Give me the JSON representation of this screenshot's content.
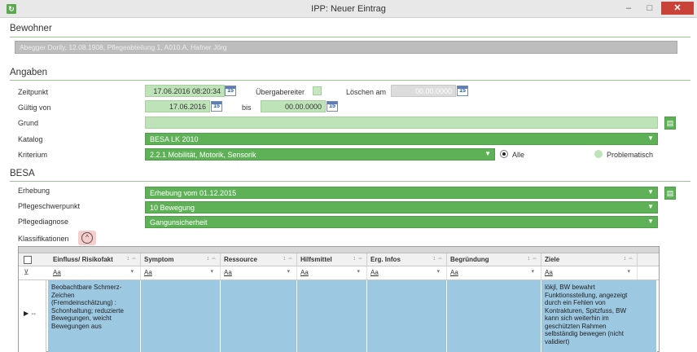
{
  "window": {
    "title": "IPP: Neuer Eintrag",
    "min_glyph": "–",
    "max_glyph": "□",
    "close_glyph": "✕"
  },
  "bewohner": {
    "heading": "Bewohner",
    "value": "Abegger Dorily, 12.08.1908, Pflegeabteilung 1, A010.A, Hafner Jörg"
  },
  "angaben": {
    "heading": "Angaben",
    "zeitpunkt_label": "Zeitpunkt",
    "zeitpunkt_value": "17.06.2016 08:20:34",
    "uebergabe_label": "Übergabereiter",
    "loeschen_label": "Löschen am",
    "loeschen_value": "00.00.0000",
    "gueltig_label": "Gültig von",
    "gueltig_value": "17.06.2016",
    "bis_label": "bis",
    "bis_value": "00.00.0000",
    "grund_label": "Grund",
    "grund_value": "",
    "katalog_label": "Katalog",
    "katalog_value": "BESA LK 2010",
    "kriterium_label": "Kriterium",
    "kriterium_value": "2.2.1   Mobilität, Motorik, Sensorik",
    "filter_alle": "Alle",
    "filter_problematisch": "Problematisch",
    "calendar_glyph": "15"
  },
  "besa": {
    "heading": "BESA",
    "erhebung_label": "Erhebung",
    "erhebung_value": "Erhebung vom   01.12.2015",
    "schwerpunkt_label": "Pflegeschwerpunkt",
    "schwerpunkt_value": "10   Bewegung",
    "diagnose_label": "Pflegediagnose",
    "diagnose_value": "Gangunsicherheit",
    "klassifikationen_label": "Klassifikationen",
    "collapse_glyph": "^"
  },
  "grid": {
    "filter_placeholder": "Aa",
    "sort_glyph": "↕ ⇔",
    "columns": [
      "Einfluss/ Risikofakt",
      "Symptom",
      "Ressource",
      "Hilfsmittel",
      "Erg. Infos",
      "Begründung",
      "Ziele"
    ],
    "row": {
      "marker": "▶ ⇔",
      "cells": [
        "Beobachtbare Schmerz-\nZeichen\n(Fremdeinschätzung) :\nSchonhaltung; reduzierte\nBewegungen, weicht\nBewegungen aus",
        "",
        "",
        "",
        "",
        "",
        "lökjl, BW bewahrt\nFunktionsstellung, angezeigt\ndurch ein Fehlen von\nKontrakturen, Spitzfuss, BW\nkann sich weiterhin im\ngeschützten Rahmen\nselbständig bewegen (nicht\nvalidiert)"
      ]
    }
  },
  "colors": {
    "accent_green": "#5fb157",
    "light_green": "#bfe3b8",
    "row_selected": "#9cc8e2",
    "close_red": "#c9423a"
  },
  "icons": {
    "calendar": "calendar-icon",
    "clipboard": "clipboard-icon",
    "collapse": "chevron-up-icon",
    "funnel": "filter-icon"
  }
}
